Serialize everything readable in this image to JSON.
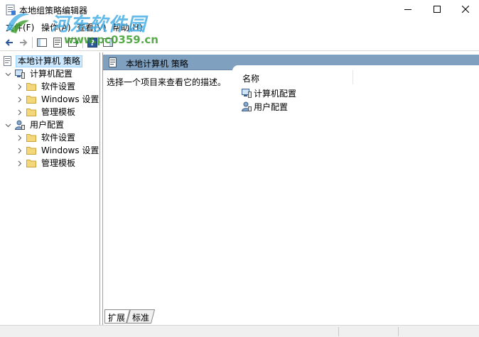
{
  "window": {
    "title": "本地组策略编辑器",
    "controls": [
      "minimize-icon",
      "maximize-icon",
      "close-icon"
    ]
  },
  "watermark": {
    "name": "河东软件园",
    "url": "www.pc0359.cn"
  },
  "menu": {
    "items": [
      {
        "label": "文件(F)"
      },
      {
        "label": "操作(A)"
      },
      {
        "label": "查看(V)"
      },
      {
        "label": "帮助(H)"
      }
    ]
  },
  "toolbar": {
    "buttons": [
      "back-arrow-icon",
      "forward-arrow-icon",
      "console-tree-icon",
      "properties-icon",
      "export-list-icon",
      "help-icon",
      "show-hide-icon"
    ]
  },
  "tree": {
    "root": {
      "label": "本地计算机 策略",
      "icon": "policy-icon"
    },
    "computer_config": {
      "label": "计算机配置",
      "icon": "computer-icon"
    },
    "computer_children": [
      {
        "label": "软件设置"
      },
      {
        "label": "Windows 设置"
      },
      {
        "label": "管理模板"
      }
    ],
    "user_config": {
      "label": "用户配置",
      "icon": "user-icon"
    },
    "user_children": [
      {
        "label": "软件设置"
      },
      {
        "label": "Windows 设置"
      },
      {
        "label": "管理模板"
      }
    ]
  },
  "right_pane": {
    "header": "本地计算机 策略",
    "description": "选择一个项目来查看它的描述。",
    "column_name": "名称",
    "items": [
      {
        "label": "计算机配置",
        "icon": "computer-icon"
      },
      {
        "label": "用户配置",
        "icon": "user-icon"
      }
    ]
  },
  "tabs": [
    {
      "label": "扩展"
    },
    {
      "label": "标准"
    }
  ],
  "colors": {
    "header_bg": "#7fa0bf",
    "selection_bg": "#cce8ff",
    "folder": "#f4d77a"
  }
}
